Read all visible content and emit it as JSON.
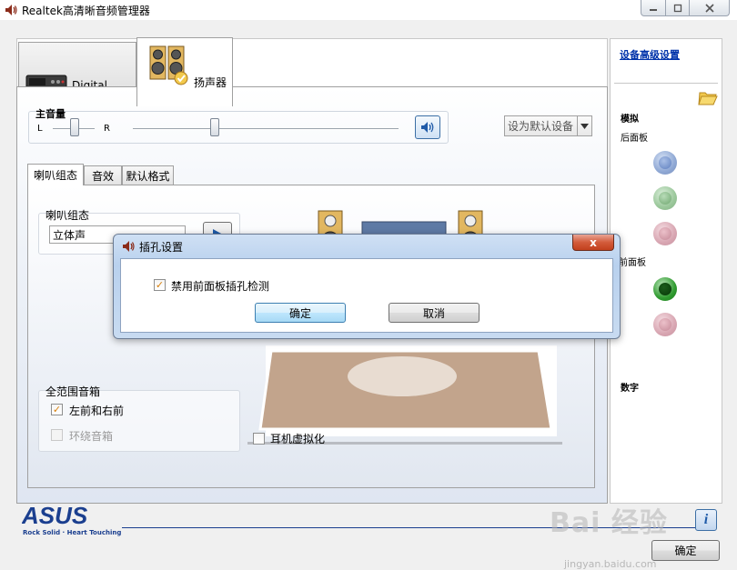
{
  "window": {
    "title": "Realtek高清晰音频管理器"
  },
  "tabs": [
    {
      "label": "Digital Output"
    },
    {
      "label": "扬声器"
    }
  ],
  "master_volume": {
    "label": "主音量",
    "left_label": "L",
    "right_label": "R",
    "balance_value": 0.5,
    "volume_value": 0.3
  },
  "default_device_label": "设为默认设备",
  "subtabs": [
    "喇叭组态",
    "音效",
    "默认格式"
  ],
  "speaker_config": {
    "group_label": "喇叭组态",
    "selected": "立体声"
  },
  "full_range": {
    "group_label": "全范围音箱",
    "front_lr": "左前和右前",
    "surround": "环绕音箱"
  },
  "headphone_virtualization": "耳机虚拟化",
  "right_panel": {
    "advanced_link": "设备高级设置",
    "analog": "模拟",
    "back_panel": "后面板",
    "front_panel": "前面板",
    "digital": "数字"
  },
  "dialog": {
    "title": "插孔设置",
    "checkbox_label": "禁用前面板插孔检测",
    "ok": "确定",
    "cancel": "取消",
    "close": "x"
  },
  "brand": {
    "logo": "ASUS",
    "tagline": "Rock Solid · Heart Touching"
  },
  "footer": {
    "ok": "确定",
    "info": "i"
  },
  "watermark": {
    "main": "Bai 经验",
    "sub": "jingyan.baidu.com"
  },
  "colors": {
    "accent_link": "#0033aa",
    "dialog_frame": "#b9d1ee",
    "asus_blue": "#1b3f8f"
  }
}
